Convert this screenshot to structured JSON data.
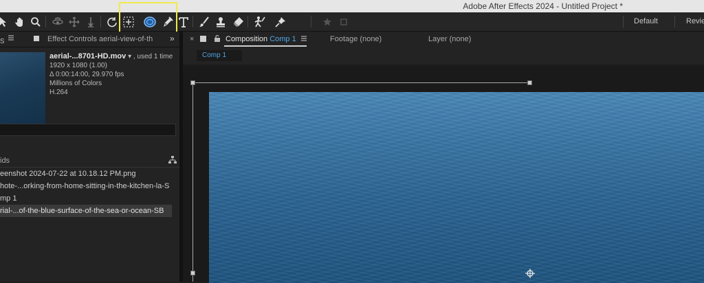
{
  "window": {
    "title": "Adobe After Effects 2024 - Untitled Project *"
  },
  "toolbar": {
    "tools": [
      "selection-tool",
      "hand-tool",
      "zoom-tool",
      "orbit-tool",
      "pan-tool",
      "dolly-tool",
      "rotate-tool",
      "pan-behind-tool",
      "ellipse-tool",
      "pen-tool",
      "type-tool",
      "brush-tool",
      "clone-stamp-tool",
      "eraser-tool",
      "roto-brush-tool",
      "puppet-pin-tool"
    ],
    "workspaces": [
      "Default",
      "Revie"
    ]
  },
  "left_panel": {
    "tab_effect_controls": "Effect Controls aerial-view-of-th",
    "footage": {
      "name": "aerial-...8701-HD.mov",
      "used": ", used 1 time",
      "resolution": "1920 x 1080 (1.00)",
      "duration": "Δ 0:00:14:00, 29.970 fps",
      "colors": "Millions of Colors",
      "codec": "H.264"
    },
    "list_header": "ids",
    "items": [
      "eenshot 2024-07-22 at 10.18.12 PM.png",
      "hote-...orking-from-home-sitting-in-the-kitchen-la-S",
      "mp 1",
      "rial-...of-the-blue-surface-of-the-sea-or-ocean-SB"
    ]
  },
  "right_panel": {
    "tabs": {
      "composition_label": "Composition",
      "composition_name": "Comp 1",
      "footage": "Footage (none)",
      "layer": "Layer (none)"
    },
    "comp_flow": "Comp 1"
  }
}
